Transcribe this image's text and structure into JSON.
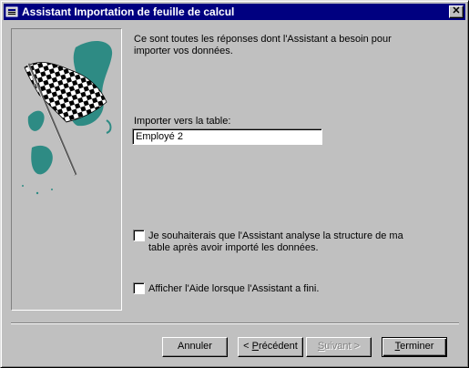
{
  "window": {
    "title": "Assistant Importation de feuille de calcul",
    "close_symbol": "✕"
  },
  "icons": {
    "system": "access-form-icon",
    "illustration": "checkered-flag-icon"
  },
  "intro": {
    "line1": "Ce sont toutes les réponses dont l'Assistant a besoin pour",
    "line2": "importer vos données."
  },
  "import_table": {
    "label": "Importer vers la table:",
    "value": "Employé 2"
  },
  "analyze_option": {
    "checked": false,
    "line1": "Je souhaiterais que l'Assistant analyse la structure de ma",
    "line2": "table après avoir importé les données."
  },
  "help_option": {
    "checked": false,
    "label": "Afficher l'Aide lorsque l'Assistant a fini."
  },
  "buttons": {
    "cancel": "Annuler",
    "previous_prefix": "< ",
    "previous_mnemonic": "P",
    "previous_rest": "récédent",
    "next_mnemonic": "S",
    "next_rest": "uivant >",
    "finish_mnemonic": "T",
    "finish_rest": "erminer"
  },
  "colors": {
    "face": "#c0c0c0",
    "titlebar": "#000080",
    "teal": "#2e8b84"
  }
}
